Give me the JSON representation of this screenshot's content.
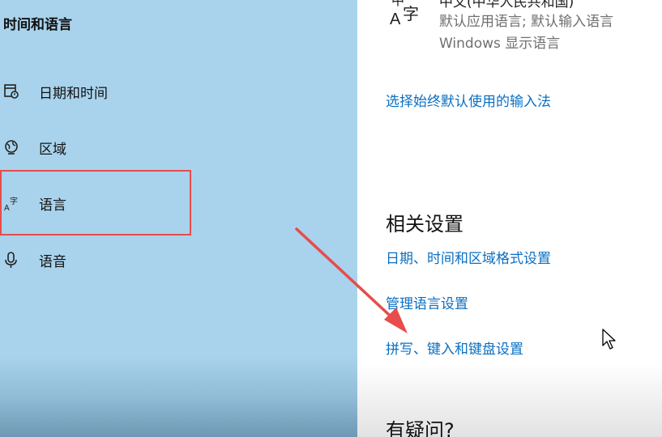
{
  "sidebar": {
    "title": "时间和语言",
    "items": [
      {
        "label": "日期和时间",
        "icon": "calendar-clock-icon"
      },
      {
        "label": "区域",
        "icon": "globe-icon"
      },
      {
        "label": "语言",
        "icon": "language-icon"
      },
      {
        "label": "语音",
        "icon": "microphone-icon"
      }
    ]
  },
  "content": {
    "language_entry": {
      "name": "中文(中华人民共和国)",
      "details": "默认应用语言; 默认输入语言",
      "display": "Windows 显示语言"
    },
    "input_method_link": "选择始终默认使用的输入法",
    "related_settings": {
      "heading": "相关设置",
      "links": [
        "日期、时间和区域格式设置",
        "管理语言设置",
        "拼写、键入和键盘设置"
      ]
    },
    "questions_heading": "有疑问?"
  },
  "colors": {
    "sidebar_bg": "#a9d3ec",
    "link": "#0a6fc2",
    "highlight": "#e84c4c"
  }
}
